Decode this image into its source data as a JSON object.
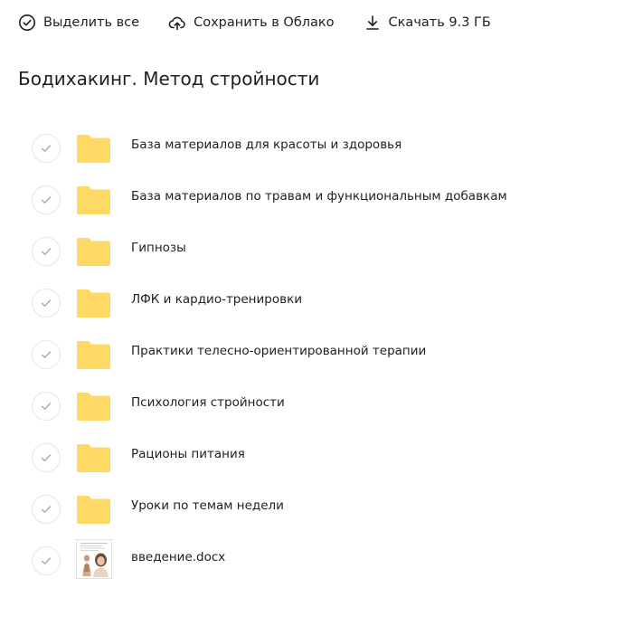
{
  "toolbar": {
    "select_all_label": "Выделить все",
    "save_cloud_label": "Сохранить в Облако",
    "download_label": "Скачать 9.3 ГБ"
  },
  "page_title": "Бодихакинг. Метод стройности",
  "files": [
    {
      "name": "База материалов для красоты и здоровья",
      "type": "folder"
    },
    {
      "name": "База материалов по травам и функциональным добавкам",
      "type": "folder"
    },
    {
      "name": "Гипнозы",
      "type": "folder"
    },
    {
      "name": "ЛФК и кардио-тренировки",
      "type": "folder"
    },
    {
      "name": "Практики телесно-ориентированной терапии",
      "type": "folder"
    },
    {
      "name": "Психология стройности",
      "type": "folder"
    },
    {
      "name": "Рационы питания",
      "type": "folder"
    },
    {
      "name": "Уроки по темам недели",
      "type": "folder"
    },
    {
      "name": "введение.docx",
      "type": "docx"
    }
  ],
  "colors": {
    "folder": "#ffd966",
    "check_border": "#e6e6e6",
    "check_mark": "#a8a8a8",
    "text": "#1f1f1f"
  }
}
